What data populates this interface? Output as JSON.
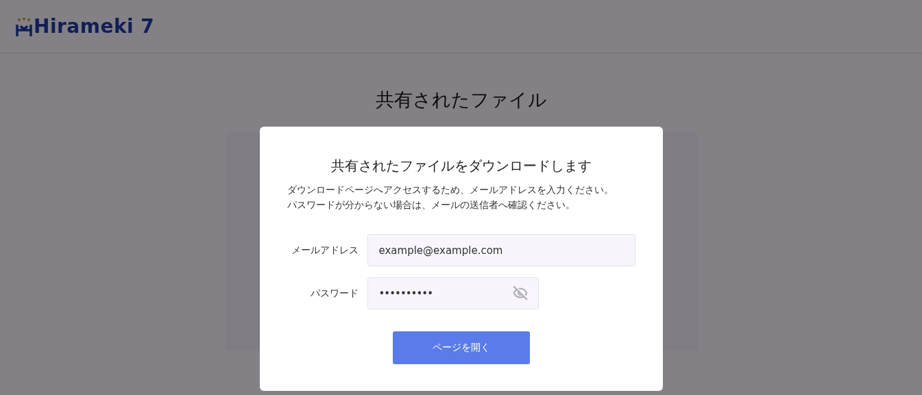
{
  "header": {
    "logo": "Hirameki 7"
  },
  "page": {
    "title": "共有されたファイル"
  },
  "dialog": {
    "title": "共有されたファイルをダウンロードします",
    "description": [
      "ダウンロードページへアクセスするため、メールアドレスを入力ください。",
      "パスワードが分からない場合は、メールの送信者へ確認ください。"
    ],
    "fields": [
      {
        "kind": "email",
        "label": "メールアドレス",
        "value": "example@example.com"
      },
      {
        "kind": "password",
        "label": "パスワード",
        "value": "••••••••••"
      }
    ],
    "button": "ページを開く"
  }
}
